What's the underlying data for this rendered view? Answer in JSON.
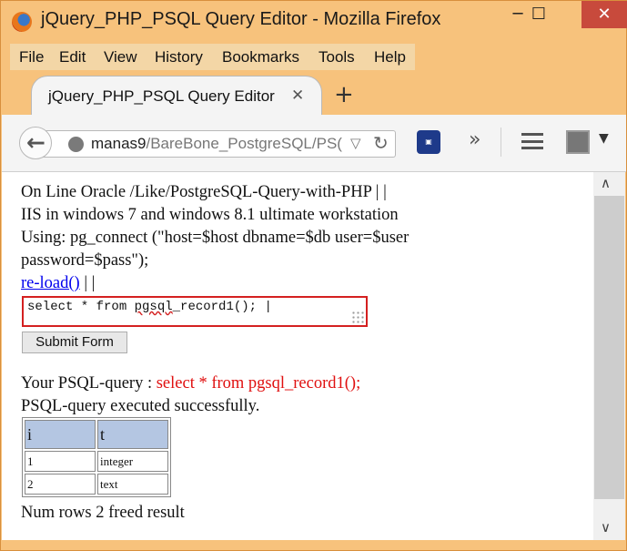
{
  "window": {
    "title": "jQuery_PHP_PSQL Query Editor - Mozilla Firefox",
    "controls": {
      "minimize": "─",
      "maximize": "☐",
      "close": "✕"
    }
  },
  "menu": [
    "File",
    "Edit",
    "View",
    "History",
    "Bookmarks",
    "Tools",
    "Help"
  ],
  "tab": {
    "title": "jQuery_PHP_PSQL Query Editor",
    "close": "✕",
    "new_tab": "+"
  },
  "navbar": {
    "url_host": "manas9",
    "url_path": "/BareBone_PostgreSQL/PS(",
    "icons": [
      "back-icon",
      "globe-icon",
      "dropdown-icon",
      "reload-icon",
      "extension-icon",
      "overflow-icon",
      "menu-icon",
      "shield-extension-icon"
    ]
  },
  "page": {
    "line1": "On Line Oracle /Like/PostgreSQL-Query-with-PHP | |",
    "line2": "IIS in windows 7 and windows 8.1 ultimate workstation",
    "line3": "Using: pg_connect (\"host=$host dbname=$db user=$user",
    "line4": "password=$pass\");",
    "reload_link": "re-load()",
    "reload_suffix": "| |",
    "query_before": "select * from ",
    "query_fn": "pgsql",
    "query_after": "_record1(); |",
    "submit_label": "Submit Form",
    "your_query_label": "Your PSQL-query : ",
    "your_query_value": "select * from pgsql_record1();",
    "status": "PSQL-query executed successfully.",
    "table": {
      "headers": [
        "i",
        "t"
      ],
      "rows": [
        [
          "1",
          "integer"
        ],
        [
          "2",
          "text"
        ]
      ]
    },
    "footer": "Num rows 2 freed result"
  },
  "colors": {
    "frame": "#f7c27c",
    "highlight_red": "#e01010",
    "table_header": "#b4c6e2",
    "link": "#0000ee"
  }
}
